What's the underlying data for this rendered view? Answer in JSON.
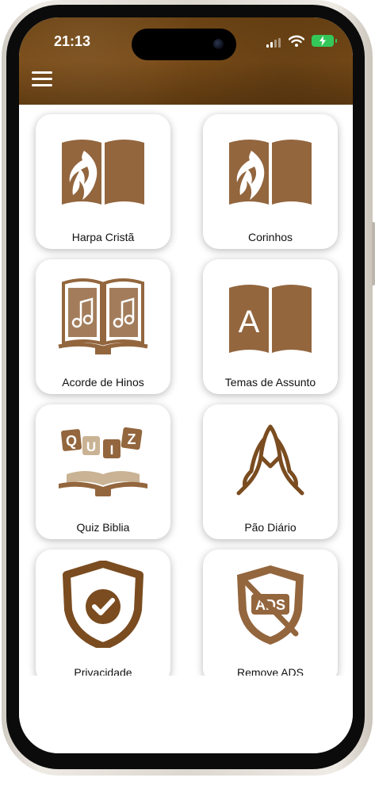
{
  "status_bar": {
    "time": "21:13"
  },
  "header": {
    "menu_icon": "hamburger-menu-icon"
  },
  "colors": {
    "brown": "#93663e",
    "header_brown": "#6d4414",
    "battery_green": "#34c759"
  },
  "menu": [
    {
      "label": "Harpa Cristã",
      "icon": "bible-flame-icon"
    },
    {
      "label": "Corinhos",
      "icon": "bible-flame-icon"
    },
    {
      "label": "Acorde de Hinos",
      "icon": "music-book-icon"
    },
    {
      "label": "Temas de Assunto",
      "icon": "alphabet-book-icon"
    },
    {
      "label": "Quiz Biblia",
      "icon": "quiz-book-icon"
    },
    {
      "label": "Pão Diário",
      "icon": "praying-hands-icon"
    },
    {
      "label": "Privacidade",
      "icon": "shield-check-icon"
    },
    {
      "label": "Remove ADS",
      "icon": "no-ads-shield-icon"
    }
  ],
  "icon_text": {
    "alphabet_letter": "A",
    "ads_text": "ADS",
    "quiz_letters": [
      "Q",
      "U",
      "I",
      "Z"
    ]
  }
}
